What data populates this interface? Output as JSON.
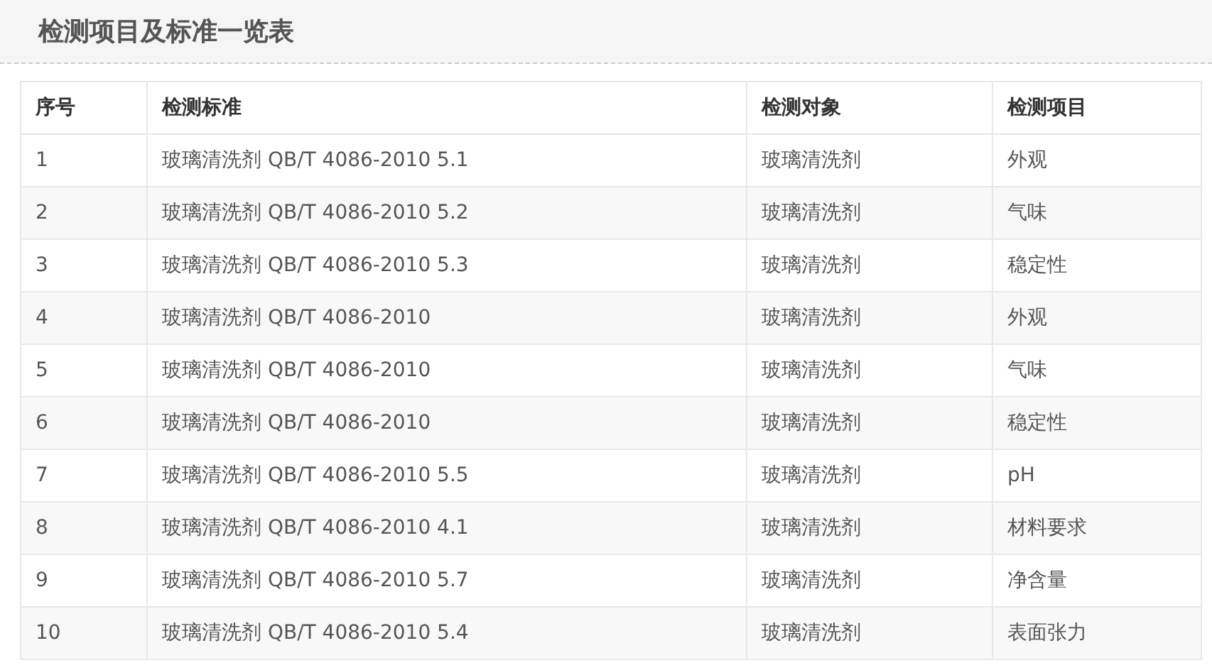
{
  "title": "检测项目及标准一览表",
  "table": {
    "columns": [
      "序号",
      "检测标准",
      "检测对象",
      "检测项目"
    ],
    "rows": [
      [
        "1",
        "玻璃清洗剂 QB/T 4086-2010 5.1",
        "玻璃清洗剂",
        "外观"
      ],
      [
        "2",
        "玻璃清洗剂 QB/T 4086-2010 5.2",
        "玻璃清洗剂",
        "气味"
      ],
      [
        "3",
        "玻璃清洗剂 QB/T 4086-2010 5.3",
        "玻璃清洗剂",
        "稳定性"
      ],
      [
        "4",
        "玻璃清洗剂 QB/T 4086-2010",
        "玻璃清洗剂",
        "外观"
      ],
      [
        "5",
        "玻璃清洗剂 QB/T 4086-2010",
        "玻璃清洗剂",
        "气味"
      ],
      [
        "6",
        "玻璃清洗剂 QB/T 4086-2010",
        "玻璃清洗剂",
        "稳定性"
      ],
      [
        "7",
        "玻璃清洗剂 QB/T 4086-2010 5.5",
        "玻璃清洗剂",
        "pH"
      ],
      [
        "8",
        "玻璃清洗剂 QB/T 4086-2010 4.1",
        "玻璃清洗剂",
        "材料要求"
      ],
      [
        "9",
        "玻璃清洗剂 QB/T 4086-2010 5.7",
        "玻璃清洗剂",
        "净含量"
      ],
      [
        "10",
        "玻璃清洗剂 QB/T 4086-2010 5.4",
        "玻璃清洗剂",
        "表面张力"
      ]
    ]
  }
}
